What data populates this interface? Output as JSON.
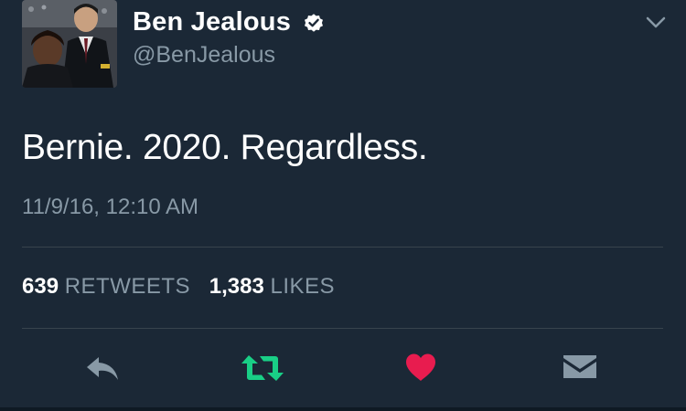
{
  "user": {
    "display_name": "Ben Jealous",
    "handle": "@BenJealous",
    "verified": true
  },
  "tweet": {
    "text": "Bernie. 2020. Regardless.",
    "timestamp": "11/9/16, 12:10 AM"
  },
  "stats": {
    "retweets_count": "639",
    "retweets_label": "RETWEETS",
    "likes_count": "1,383",
    "likes_label": "LIKES"
  },
  "actions": [
    {
      "icon": "reply-icon",
      "color": "#8899a6"
    },
    {
      "icon": "retweet-icon",
      "color": "#19cf86"
    },
    {
      "icon": "heart-icon",
      "color": "#e81c4f"
    },
    {
      "icon": "direct-message-icon",
      "color": "#8899a6"
    }
  ],
  "colors": {
    "background": "#1b2836",
    "secondary_text": "#8899a6",
    "divider": "#38444d",
    "retweet_active": "#19cf86",
    "like_active": "#e81c4f"
  }
}
